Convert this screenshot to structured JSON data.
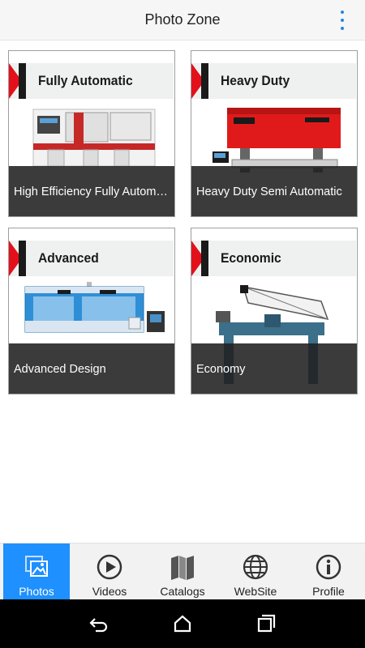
{
  "header": {
    "title": "Photo Zone",
    "menu_icon": "more-vert-icon",
    "accent": "#1e88e5"
  },
  "cards": [
    {
      "heading": "Fully Automatic",
      "caption": "High Efficiency Fully Automatic"
    },
    {
      "heading": "Heavy Duty",
      "caption": "Heavy Duty Semi Automatic"
    },
    {
      "heading": "Advanced",
      "caption": "Advanced Design"
    },
    {
      "heading": "Economic",
      "caption": "Economy"
    }
  ],
  "tabs": [
    {
      "label": "Photos",
      "icon": "photos-icon",
      "active": true
    },
    {
      "label": "Videos",
      "icon": "play-icon",
      "active": false
    },
    {
      "label": "Catalogs",
      "icon": "catalog-icon",
      "active": false
    },
    {
      "label": "WebSite",
      "icon": "globe-icon",
      "active": false
    },
    {
      "label": "Profile",
      "icon": "info-icon",
      "active": false
    }
  ],
  "navigation": {
    "back_icon": "back-icon",
    "home_icon": "home-icon",
    "recents_icon": "recents-icon"
  },
  "colors": {
    "brand_red": "#e3101c",
    "active_tab": "#1e90ff"
  }
}
